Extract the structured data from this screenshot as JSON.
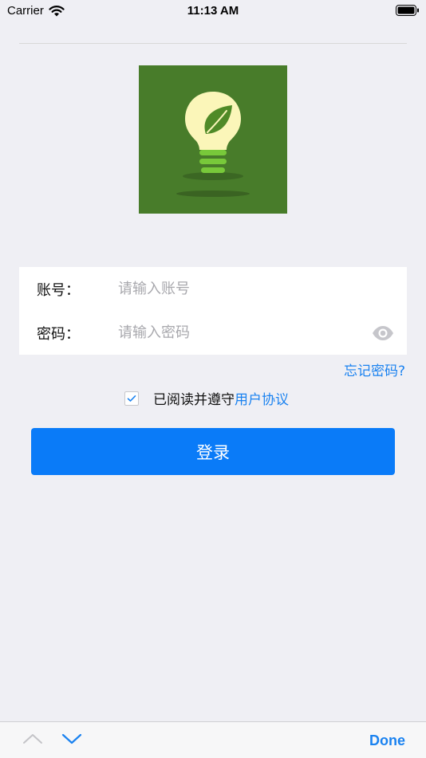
{
  "status_bar": {
    "carrier": "Carrier",
    "time": "11:13 AM"
  },
  "logo": {
    "icon": "lightbulb-leaf-icon",
    "background": "#487c2a"
  },
  "form": {
    "account_label": "账号：",
    "account_placeholder": "请输入账号",
    "account_value": "",
    "password_label": "密码：",
    "password_placeholder": "请输入密码",
    "password_value": ""
  },
  "forgot_password": "忘记密码?",
  "agreement": {
    "checked": true,
    "text": "已阅读并遵守",
    "link": "用户协议"
  },
  "login_button": "登录",
  "keyboard_toolbar": {
    "done": "Done"
  },
  "colors": {
    "accent": "#0a7bf8",
    "link": "#1a82f0",
    "background": "#efeff4"
  }
}
